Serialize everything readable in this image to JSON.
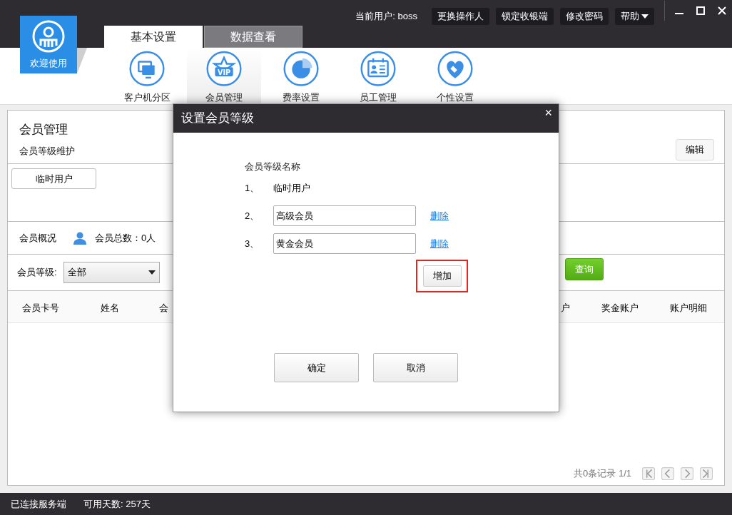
{
  "top_bar": {
    "current_user": "当前用户: boss",
    "buttons": [
      "更换操作人",
      "锁定收银端",
      "修改密码"
    ],
    "help": "帮助"
  },
  "logo": {
    "text": "欢迎使用"
  },
  "tabs": [
    {
      "label": "基本设置",
      "selected": true
    },
    {
      "label": "数据查看",
      "selected": false
    }
  ],
  "nav": [
    {
      "label": "客户机分区",
      "selected": false
    },
    {
      "label": "会员管理",
      "selected": true,
      "icon_text": "VIP"
    },
    {
      "label": "费率设置",
      "selected": false
    },
    {
      "label": "员工管理",
      "selected": false
    },
    {
      "label": "个性设置",
      "selected": false
    }
  ],
  "panel": {
    "title": "会员管理",
    "subtitle": "会员等级维护",
    "edit_button": "编辑",
    "levels": [
      "临时用户"
    ],
    "overview_label": "会员概况",
    "total": "会员总数：0人",
    "filter_label": "会员等级:",
    "filter_value": "全部",
    "query_button": "查询",
    "columns": [
      "会员卡号",
      "姓名",
      "会",
      "户",
      "奖金账户",
      "账户明细"
    ],
    "pagination": "共0条记录 1/1"
  },
  "dialog": {
    "title": "设置会员等级",
    "close": "×",
    "column_label": "会员等级名称",
    "rows": [
      {
        "number": "1、",
        "kind": "text",
        "value": "临时用户"
      },
      {
        "number": "2、",
        "kind": "input",
        "value": "高级会员",
        "delete": "删除"
      },
      {
        "number": "3、",
        "kind": "input",
        "value": "黄金会员",
        "delete": "删除"
      }
    ],
    "add_button": "增加",
    "add_highlighted": true,
    "ok": "确定",
    "cancel": "取消"
  },
  "status_bar": [
    "已连接服务端",
    "可用天数: 257天"
  ]
}
